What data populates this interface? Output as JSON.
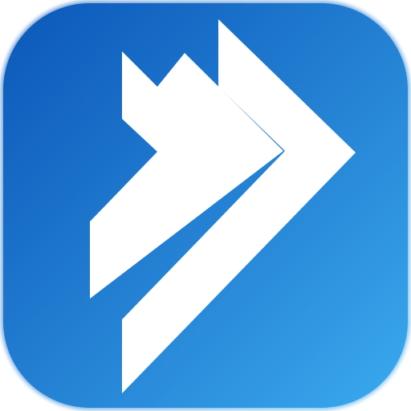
{
  "icon": {
    "name": "double-chevron-right-icon",
    "colors": {
      "gradient_start": "#0b57b9",
      "gradient_mid": "#237fd2",
      "gradient_end": "#3aaaef",
      "glyph": "#ffffff"
    }
  }
}
